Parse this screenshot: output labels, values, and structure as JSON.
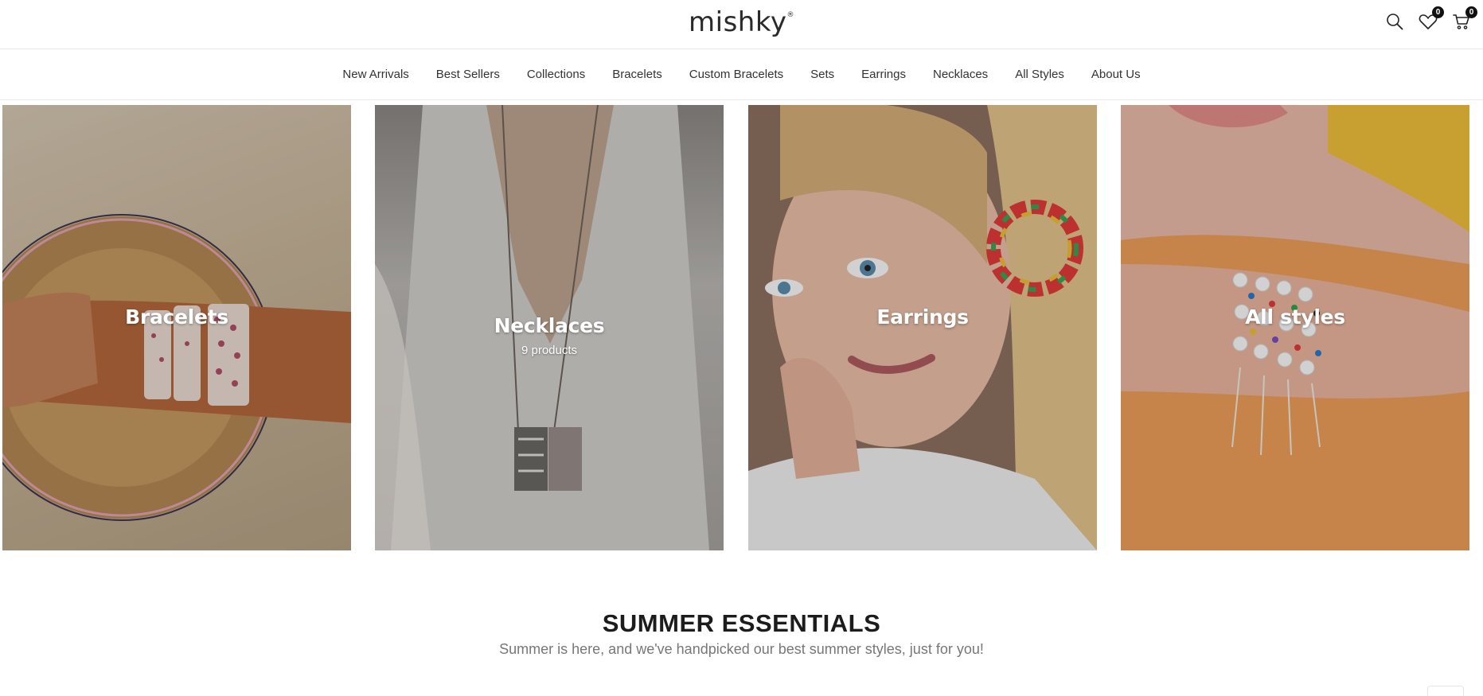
{
  "header": {
    "logo": "mishky",
    "logo_mark": "®",
    "wishlist_count": "0",
    "cart_count": "0",
    "icons": [
      "search-icon",
      "heart-icon",
      "cart-icon"
    ]
  },
  "nav": {
    "items": [
      {
        "label": "New Arrivals"
      },
      {
        "label": "Best Sellers"
      },
      {
        "label": "Collections"
      },
      {
        "label": "Bracelets"
      },
      {
        "label": "Custom Bracelets"
      },
      {
        "label": "Sets"
      },
      {
        "label": "Earrings"
      },
      {
        "label": "Necklaces"
      },
      {
        "label": "All Styles"
      },
      {
        "label": "About Us"
      }
    ]
  },
  "categories": [
    {
      "title": "Bracelets",
      "count": ""
    },
    {
      "title": "Necklaces",
      "count": "9 products"
    },
    {
      "title": "Earrings",
      "count": ""
    },
    {
      "title": "All styles",
      "count": ""
    }
  ],
  "section": {
    "title": "SUMMER ESSENTIALS",
    "subtitle": "Summer is here, and we've handpicked our best summer styles, just for you!"
  }
}
